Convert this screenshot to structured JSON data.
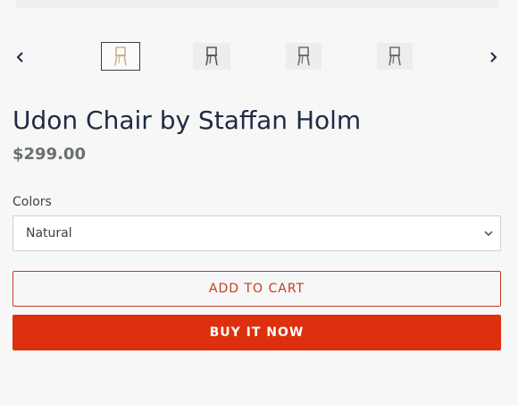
{
  "gallery": {
    "prev_icon": "chevron-left-icon",
    "next_icon": "chevron-right-icon",
    "thumbnails": [
      {
        "icon": "chair-icon",
        "color": "#c9b28f",
        "selected": true
      },
      {
        "icon": "chair-icon",
        "color": "#555a5e",
        "selected": false
      },
      {
        "icon": "chair-icon",
        "color": "#6a6e72",
        "selected": false
      },
      {
        "icon": "chair-icon",
        "color": "#6a6e72",
        "selected": false
      }
    ]
  },
  "product": {
    "title": "Udon Chair by Staffan Holm",
    "price": "$299.00"
  },
  "options": {
    "label": "Colors",
    "selected": "Natural",
    "chevron_icon": "chevron-down-icon"
  },
  "buttons": {
    "add_to_cart": "ADD TO CART",
    "buy_now": "BUY IT NOW"
  },
  "colors": {
    "accent": "#dd300f",
    "title": "#1f2a44",
    "background": "#f7f7f7"
  }
}
